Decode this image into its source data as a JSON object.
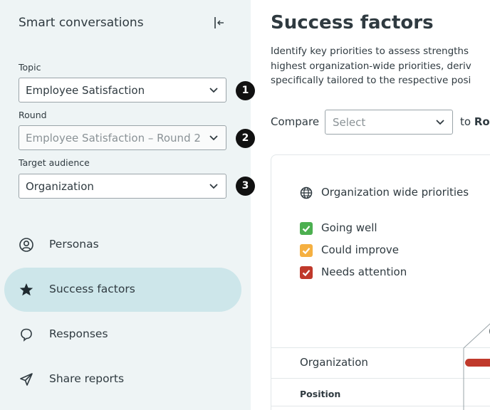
{
  "sidebar": {
    "title": "Smart conversations",
    "collapse_icon": "collapse-left-icon",
    "fields": [
      {
        "label": "Topic",
        "value": "Employee Satisfaction",
        "badge": "1",
        "disabled": false
      },
      {
        "label": "Round",
        "value": "Employee Satisfaction – Round 2",
        "badge": "2",
        "disabled": true
      },
      {
        "label": "Target audience",
        "value": "Organization",
        "badge": "3",
        "disabled": false
      }
    ],
    "nav": [
      {
        "label": "Personas",
        "icon": "user-circle-icon",
        "active": false
      },
      {
        "label": "Success factors",
        "icon": "star-icon",
        "active": true
      },
      {
        "label": "Responses",
        "icon": "chat-bubble-icon",
        "active": false
      },
      {
        "label": "Share reports",
        "icon": "send-icon",
        "active": false
      }
    ]
  },
  "main": {
    "title": "Success factors",
    "description_lines": [
      "Identify key priorities to assess strengths",
      "highest organization-wide priorities, deriv",
      "specifically tailored to the respective posi"
    ],
    "compare_label": "Compare",
    "compare_placeholder": "Select",
    "to_label": "to",
    "to_value": "Rou",
    "legend_title": "Organization wide priorities",
    "legend_title_icon": "globe-icon",
    "legend": [
      {
        "label": "Going well",
        "color": "#4caf50"
      },
      {
        "label": "Could improve",
        "color": "#f5b041"
      },
      {
        "label": "Needs attention",
        "color": "#c0392b"
      }
    ],
    "row_organization": "Organization",
    "row_position": "Position"
  },
  "colors": {
    "sidebar_bg": "#eef4f5",
    "active_nav_bg": "#cde6ea",
    "text": "#2f3a40"
  }
}
